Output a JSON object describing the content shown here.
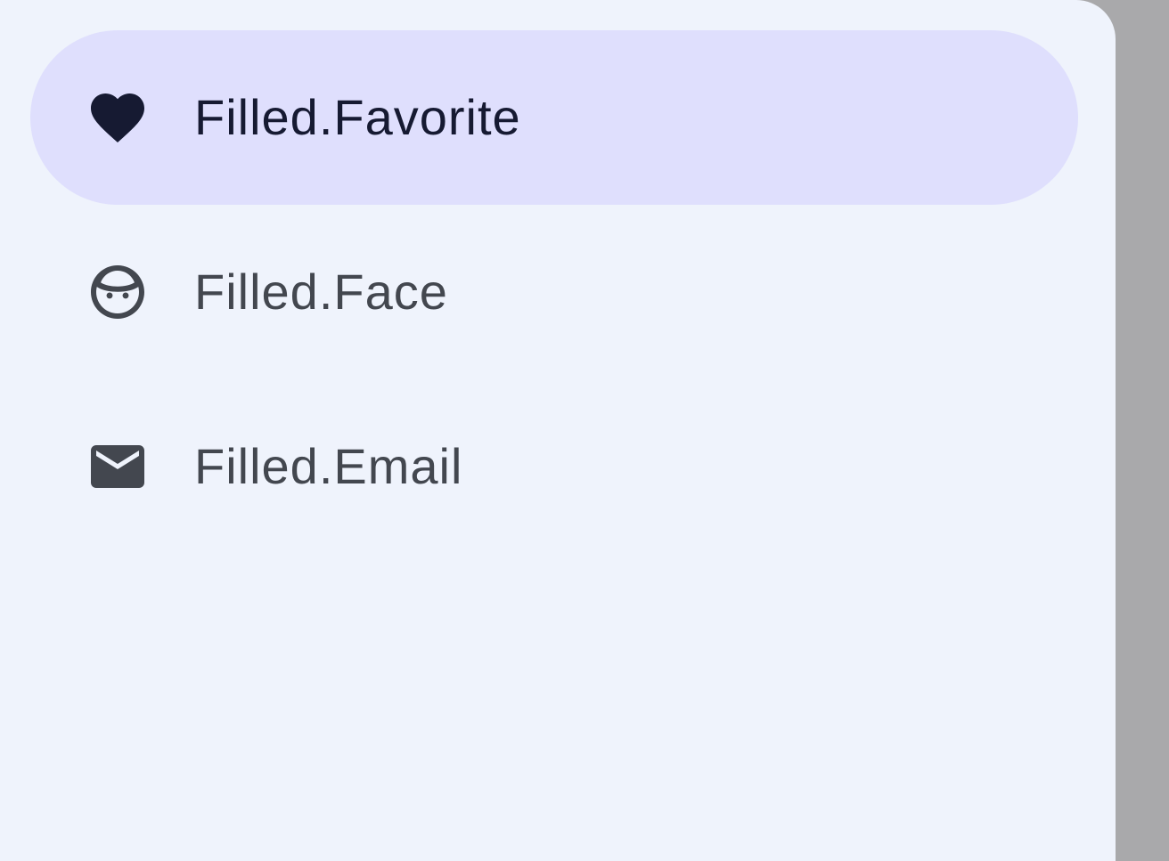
{
  "colors": {
    "drawer_background": "#eff3fc",
    "selected_indicator": "#dfdffd",
    "selected_text": "#161a32",
    "unselected_text": "#43474f",
    "scrim": "#a9a9ab"
  },
  "drawer": {
    "items": [
      {
        "label": "Filled.Favorite",
        "icon": "favorite-icon",
        "selected": true
      },
      {
        "label": "Filled.Face",
        "icon": "face-icon",
        "selected": false
      },
      {
        "label": "Filled.Email",
        "icon": "email-icon",
        "selected": false
      }
    ]
  }
}
